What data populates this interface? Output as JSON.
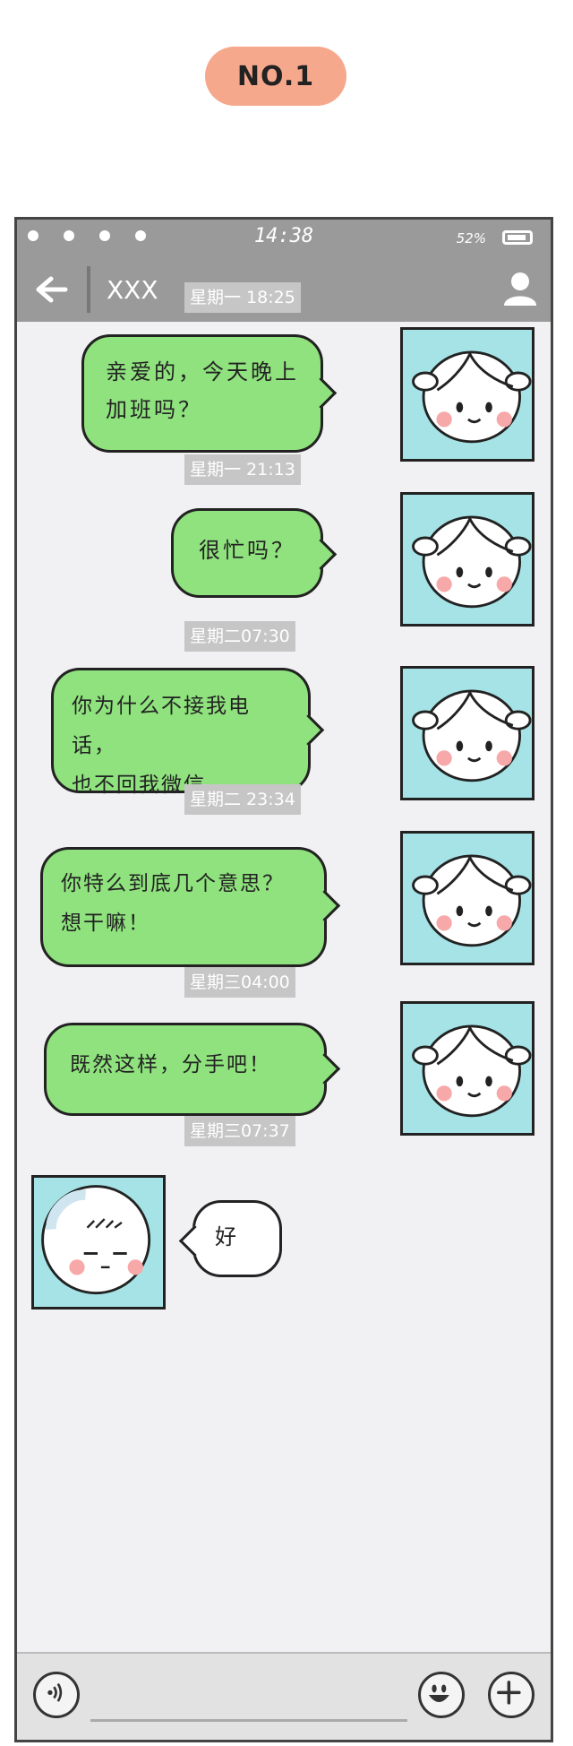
{
  "badge": "NO.1",
  "status": {
    "time": "14:38",
    "battery": "52%"
  },
  "header": {
    "title": "XXX"
  },
  "messages": [
    {
      "time": "星期一 18:25",
      "line1": "亲爱的，今天晚上",
      "line2": "加班吗？"
    },
    {
      "time": "星期一 21:13",
      "line1": "很忙吗？",
      "line2": ""
    },
    {
      "time": "星期二07:30",
      "line1": "你为什么不接我电话，",
      "line2": "也不回我微信"
    },
    {
      "time": "星期二 23:34",
      "line1": "你特么到底几个意思？",
      "line2": "想干嘛！"
    },
    {
      "time": "星期三04:00",
      "line1": "既然这样，分手吧！",
      "line2": ""
    },
    {
      "time": "星期三07:37",
      "line1": "好",
      "line2": ""
    }
  ],
  "icons": [
    "back-arrow-icon",
    "user-icon",
    "voice-icon",
    "emoji-icon",
    "plus-icon"
  ]
}
